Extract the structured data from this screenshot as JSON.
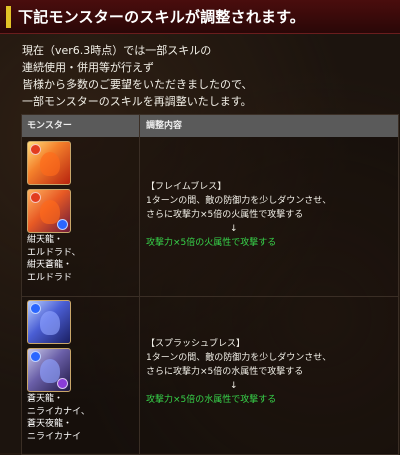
{
  "header": {
    "title": "下記モンスターのスキルが調整されます。"
  },
  "intro": {
    "lines": [
      "現在（ver6.3時点）では一部スキルの",
      "連続使用・併用等が行えず",
      "皆様から多数のご要望をいただきましたので、",
      "一部モンスターのスキルを再調整いたします。"
    ]
  },
  "table": {
    "headers": [
      "モンスター",
      "調整内容"
    ],
    "rows": [
      {
        "icons": [
          "fire-dragon-icon",
          "blue-fire-dragon-icon"
        ],
        "names": [
          "紺天龍・",
          "エルドラド、",
          "紺天蒼龍・",
          "エルドラド"
        ],
        "skill_name": "【フレイムブレス】",
        "before": [
          "1ターンの間、敵の防御力を少しダウンさせ、",
          "さらに攻撃力×5倍の火属性で攻撃する"
        ],
        "arrow": "↓",
        "after": "攻撃力×5倍の火属性で攻撃する"
      },
      {
        "icons": [
          "water-dragon-icon",
          "dark-water-dragon-icon"
        ],
        "names": [
          "蒼天龍・",
          "ニライカナイ、",
          "蒼天夜龍・",
          "ニライカナイ"
        ],
        "skill_name": "【スプラッシュブレス】",
        "before": [
          "1ターンの間、敵の防御力を少しダウンさせ、",
          "さらに攻撃力×5倍の水属性で攻撃する"
        ],
        "arrow": "↓",
        "after": "攻撃力×5倍の水属性で攻撃する"
      }
    ]
  },
  "colors": {
    "header_bg": "#4a0d0d",
    "header_accent": "#e3c227",
    "result_text": "#37d44a",
    "table_header": "#5a5a5a"
  }
}
